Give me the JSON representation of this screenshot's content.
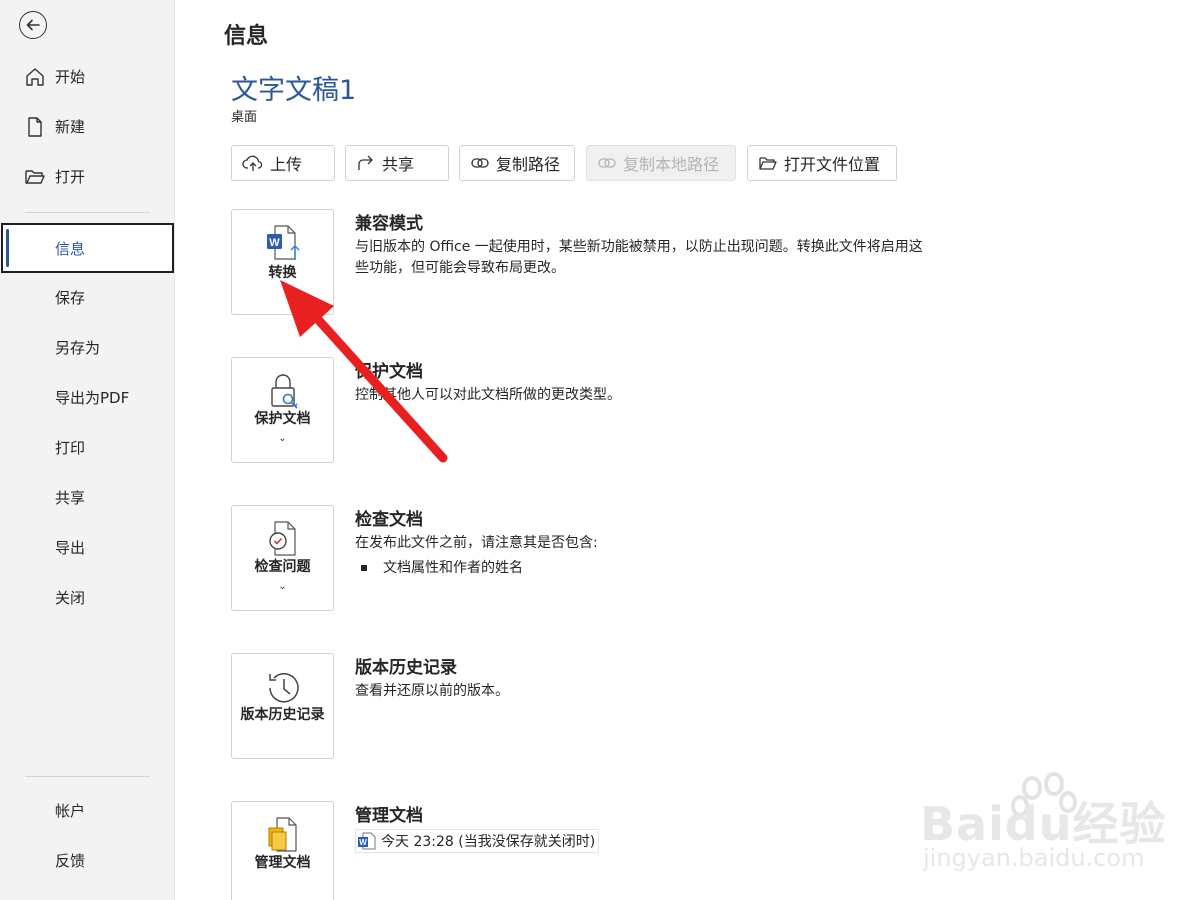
{
  "sidebar": {
    "items": [
      {
        "label": "开始"
      },
      {
        "label": "新建"
      },
      {
        "label": "打开"
      },
      {
        "label": "信息"
      },
      {
        "label": "保存"
      },
      {
        "label": "另存为"
      },
      {
        "label": "导出为PDF"
      },
      {
        "label": "打印"
      },
      {
        "label": "共享"
      },
      {
        "label": "导出"
      },
      {
        "label": "关闭"
      },
      {
        "label": "帐户"
      },
      {
        "label": "反馈"
      }
    ],
    "active": "信息"
  },
  "page": {
    "title": "信息",
    "doc_title": "文字文稿1",
    "doc_location": "桌面"
  },
  "toolbar": {
    "upload": "上传",
    "share": "共享",
    "copy_path": "复制路径",
    "copy_local_path": "复制本地路径",
    "open_location": "打开文件位置"
  },
  "sections": {
    "compat": {
      "tile_label": "转换",
      "heading": "兼容模式",
      "desc": "与旧版本的 Office 一起使用时，某些新功能被禁用，以防止出现问题。转换此文件将启用这些功能，但可能会导致布局更改。"
    },
    "protect": {
      "tile_label": "保护文档",
      "heading": "保护文档",
      "desc": "控制其他人可以对此文档所做的更改类型。"
    },
    "inspect": {
      "tile_label": "检查问题",
      "heading": "检查文档",
      "desc": "在发布此文件之前，请注意其是否包含:",
      "bullets": [
        "文档属性和作者的姓名"
      ]
    },
    "history": {
      "tile_label": "版本历史记录",
      "heading": "版本历史记录",
      "desc": "查看并还原以前的版本。"
    },
    "manage": {
      "tile_label": "管理文档",
      "heading": "管理文档",
      "version_entry": "今天 23:28 (当我没保存就关闭时)"
    }
  },
  "watermark": {
    "main": "Baidu经验",
    "sub": "jingyan.baidu.com"
  },
  "colors": {
    "accent": "#2b579a",
    "arrow": "#e8201f",
    "sidebar_bg": "#f3f3f3"
  }
}
